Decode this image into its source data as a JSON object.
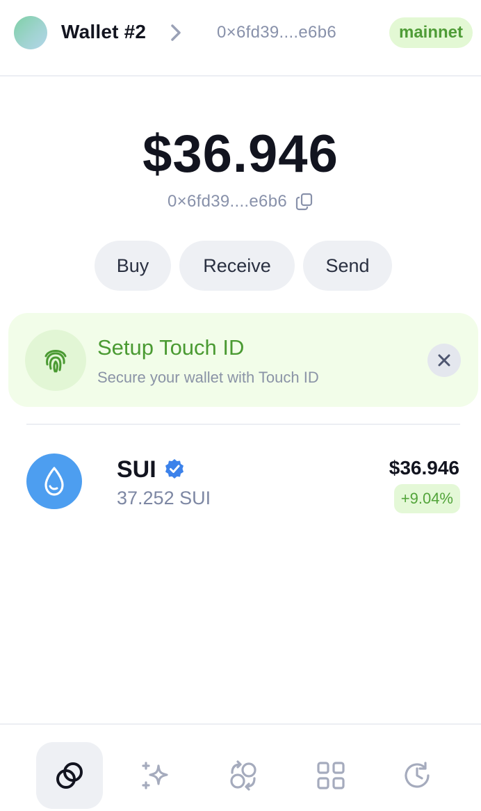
{
  "header": {
    "wallet_name": "Wallet #2",
    "address": "0×6fd39....e6b6",
    "network": "mainnet"
  },
  "balance": {
    "amount": "$36.946",
    "address": "0×6fd39....e6b6"
  },
  "actions": {
    "buy": "Buy",
    "receive": "Receive",
    "send": "Send"
  },
  "touch_banner": {
    "title": "Setup Touch ID",
    "subtitle": "Secure your wallet with Touch ID"
  },
  "tokens": [
    {
      "symbol": "SUI",
      "amount": "37.252 SUI",
      "value": "$36.946",
      "change": "+9.04%"
    }
  ],
  "nav": {
    "items": [
      "home-icon",
      "sparkle-icon",
      "swap-icon",
      "apps-icon",
      "history-icon"
    ],
    "active": "home-icon"
  },
  "colors": {
    "accent_green": "#4a9a32",
    "badge_green_bg": "#e3f8d4",
    "sui_blue": "#4d9ef0",
    "muted_text": "#8891aa"
  }
}
